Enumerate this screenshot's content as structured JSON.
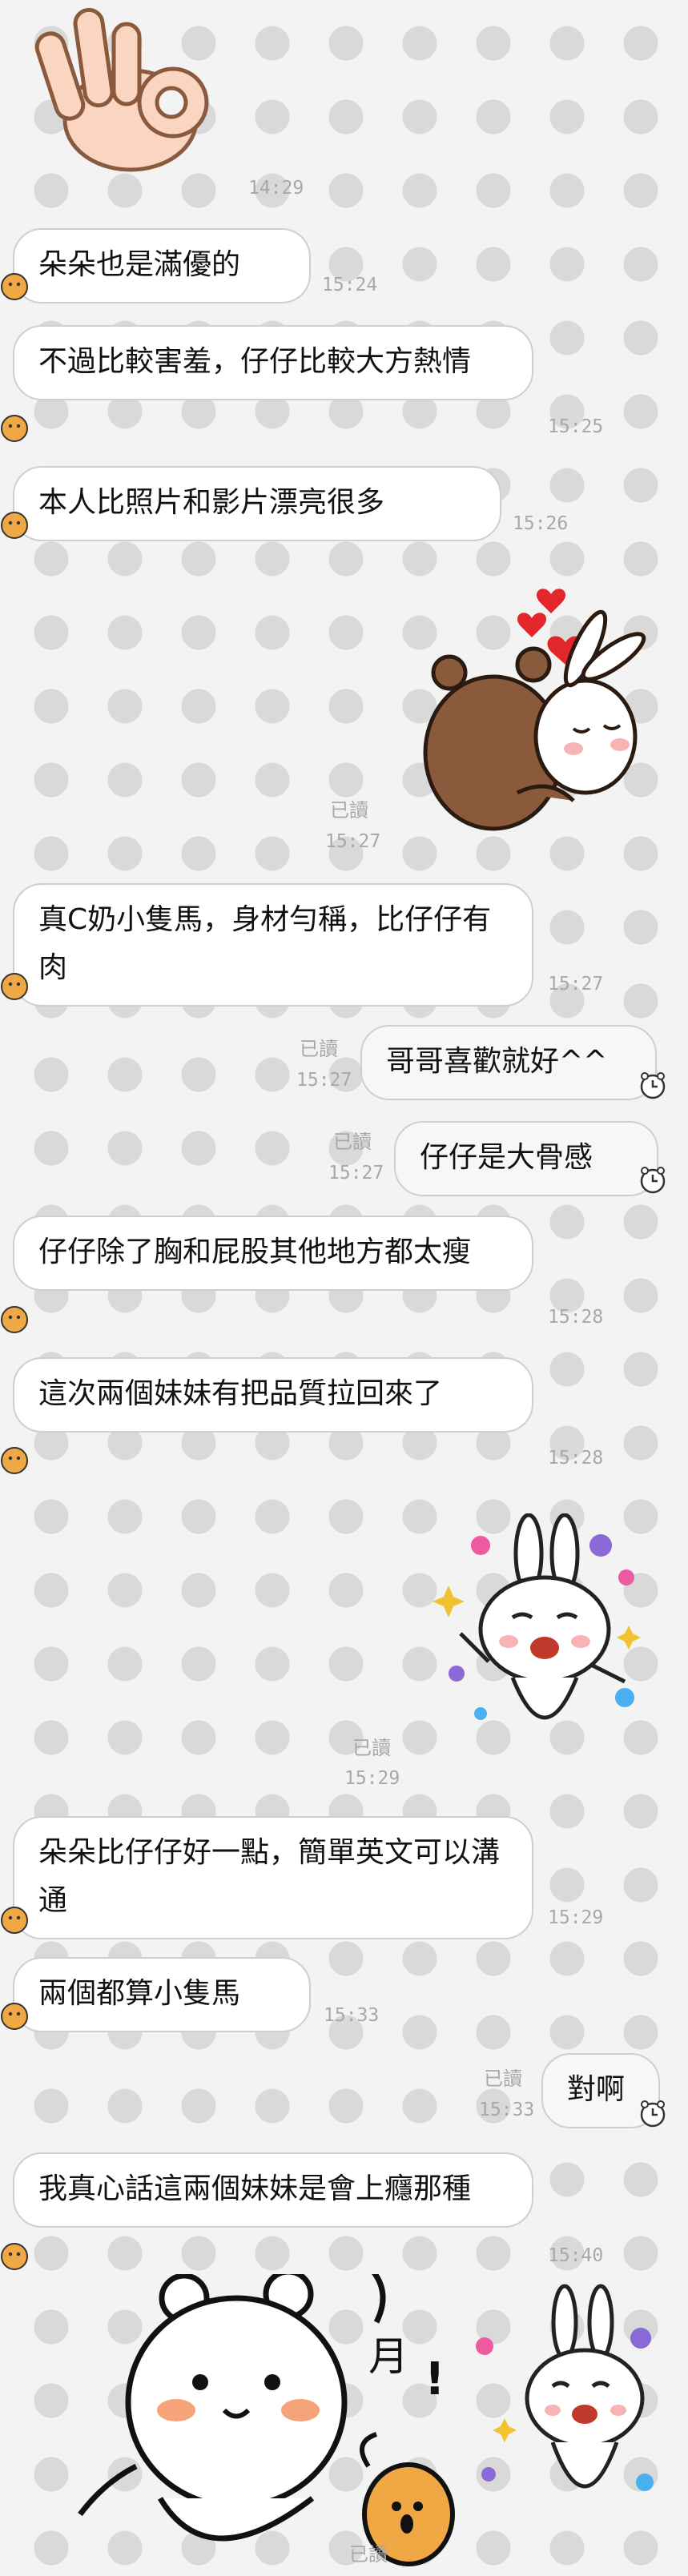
{
  "messages": [
    {
      "id": "s1",
      "type": "sticker",
      "sticker": "ok-hand-sticker",
      "time": "14:29"
    },
    {
      "id": "m1",
      "side": "in",
      "text": "朵朵也是滿優的",
      "time": "15:24"
    },
    {
      "id": "m2",
      "side": "in",
      "text": "不過比較害羞，仔仔比較大方熱情",
      "time": "15:25"
    },
    {
      "id": "m3",
      "side": "in",
      "text": "本人比照片和影片漂亮很多",
      "time": "15:26"
    },
    {
      "id": "s2",
      "type": "sticker",
      "sticker": "brown-cony-kiss-sticker",
      "read": "已讀",
      "time": "15:27"
    },
    {
      "id": "m4",
      "side": "in",
      "text": "真C奶小隻馬，身材勻稱，比仔仔有肉",
      "time": "15:27"
    },
    {
      "id": "m5",
      "side": "out",
      "text": "哥哥喜歡就好^^",
      "read": "已讀",
      "time": "15:27"
    },
    {
      "id": "m6",
      "side": "out",
      "text": "仔仔是大骨感",
      "read": "已讀",
      "time": "15:27"
    },
    {
      "id": "m7",
      "side": "in",
      "text": "仔仔除了胸和屁股其他地方都太瘦",
      "time": "15:28"
    },
    {
      "id": "m8",
      "side": "in",
      "text": "這次兩個妹妹有把品質拉回來了",
      "time": "15:28"
    },
    {
      "id": "s3",
      "type": "sticker",
      "sticker": "cony-flowers-sticker",
      "read": "已讀",
      "time": "15:29"
    },
    {
      "id": "m9",
      "side": "in",
      "text": "朵朵比仔仔好一點，簡單英文可以溝通",
      "time": "15:29"
    },
    {
      "id": "m10",
      "side": "in",
      "text": "兩個都算小隻馬",
      "time": "15:33"
    },
    {
      "id": "m11",
      "side": "out",
      "text": "對啊",
      "read": "已讀",
      "time": "15:33"
    },
    {
      "id": "m12",
      "side": "in",
      "text": "我真心話這兩個妹妹是會上癮那種",
      "time": "15:40"
    },
    {
      "id": "s4",
      "type": "sticker",
      "sticker": "bear-cony-dance-sticker",
      "read": "已讀"
    }
  ],
  "colors": {
    "bubble": "#ffffff",
    "border": "#cfcfcf",
    "time": "#a8a8a8",
    "bg": "#f3f3f3",
    "dot": "#d9d9d9",
    "avatar": "#f0a844"
  },
  "icons": {
    "incoming": "avatar-chick-icon",
    "outgoing": "clock-face-icon"
  }
}
